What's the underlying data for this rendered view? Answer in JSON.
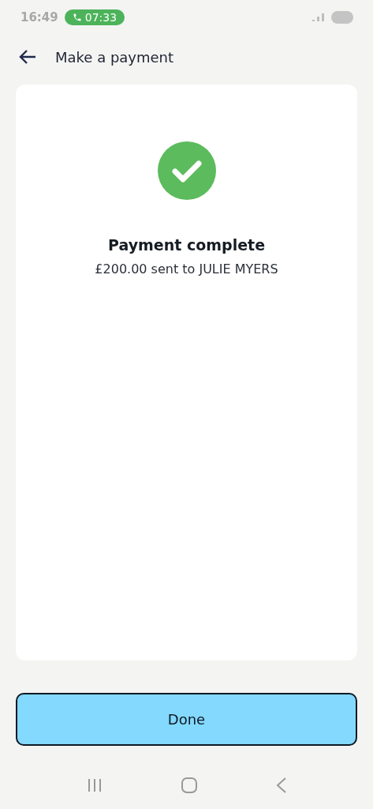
{
  "status_bar": {
    "time": "16:49",
    "call_timer": "07:33"
  },
  "header": {
    "title": "Make a payment"
  },
  "result": {
    "title": "Payment complete",
    "message": "£200.00 sent to JULIE MYERS"
  },
  "buttons": [
    "Done"
  ]
}
